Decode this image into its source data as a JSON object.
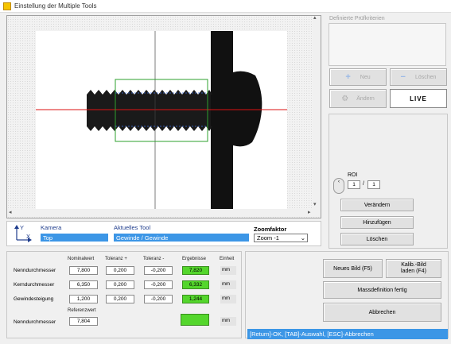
{
  "window": {
    "title": "Einstellung der Multiple Tools"
  },
  "criteria": {
    "label": "Definierte Prüfkriterien"
  },
  "buttons": {
    "neu": "Neu",
    "loeschen_top": "Löschen",
    "aendern": "Ändern",
    "live": "LIVE",
    "veraendern": "Verändern",
    "hinzufuegen": "Hinzufügen",
    "loeschen_roi": "Löschen",
    "neues_bild": "Neues Bild (F5)",
    "kalib_line1": "Kalib.-Bild",
    "kalib_line2": "laden (F4)",
    "massdefinition": "Massdefinition  fertig",
    "abbrechen": "Abbrechen"
  },
  "roi": {
    "label": "ROI",
    "value1": "1",
    "separator": "/",
    "value2": "1"
  },
  "info": {
    "kamera_label": "Kamera",
    "kamera_value": "Top",
    "tool_label": "Aktuelles Tool",
    "tool_value": "Gewinde / Gewinde",
    "zoom_label": "Zoomfaktor",
    "zoom_value": "Zoom -1",
    "axis_y": "Y",
    "axis_x": "X"
  },
  "table": {
    "headers": [
      "Nominalwert",
      "Toleranz +",
      "Toleranz -",
      "Ergebnisse",
      "Einheit"
    ],
    "rows": [
      {
        "label": "Nenndurchmesser",
        "nominal": "7,800",
        "tol_plus": "0,200",
        "tol_minus": "-0,200",
        "result": "7,820",
        "unit": "mm"
      },
      {
        "label": "Kerndurchmesser",
        "nominal": "6,350",
        "tol_plus": "0,200",
        "tol_minus": "-0,200",
        "result": "6,332",
        "unit": "mm"
      },
      {
        "label": "Gewindesteigung",
        "nominal": "1,200",
        "tol_plus": "0,200",
        "tol_minus": "-0,200",
        "result": "1,244",
        "unit": "mm"
      }
    ],
    "ref_header": "Referenzwert",
    "ref_row": {
      "label": "Nenndurchmesser",
      "value": "7,804",
      "result": "",
      "unit": "mm"
    }
  },
  "status": {
    "text": "[Return]-OK, [TAB]-Auswahl, [ESC]-Abbrechen"
  },
  "colors": {
    "accent": "#3c96e6",
    "ok": "#54d62c"
  }
}
